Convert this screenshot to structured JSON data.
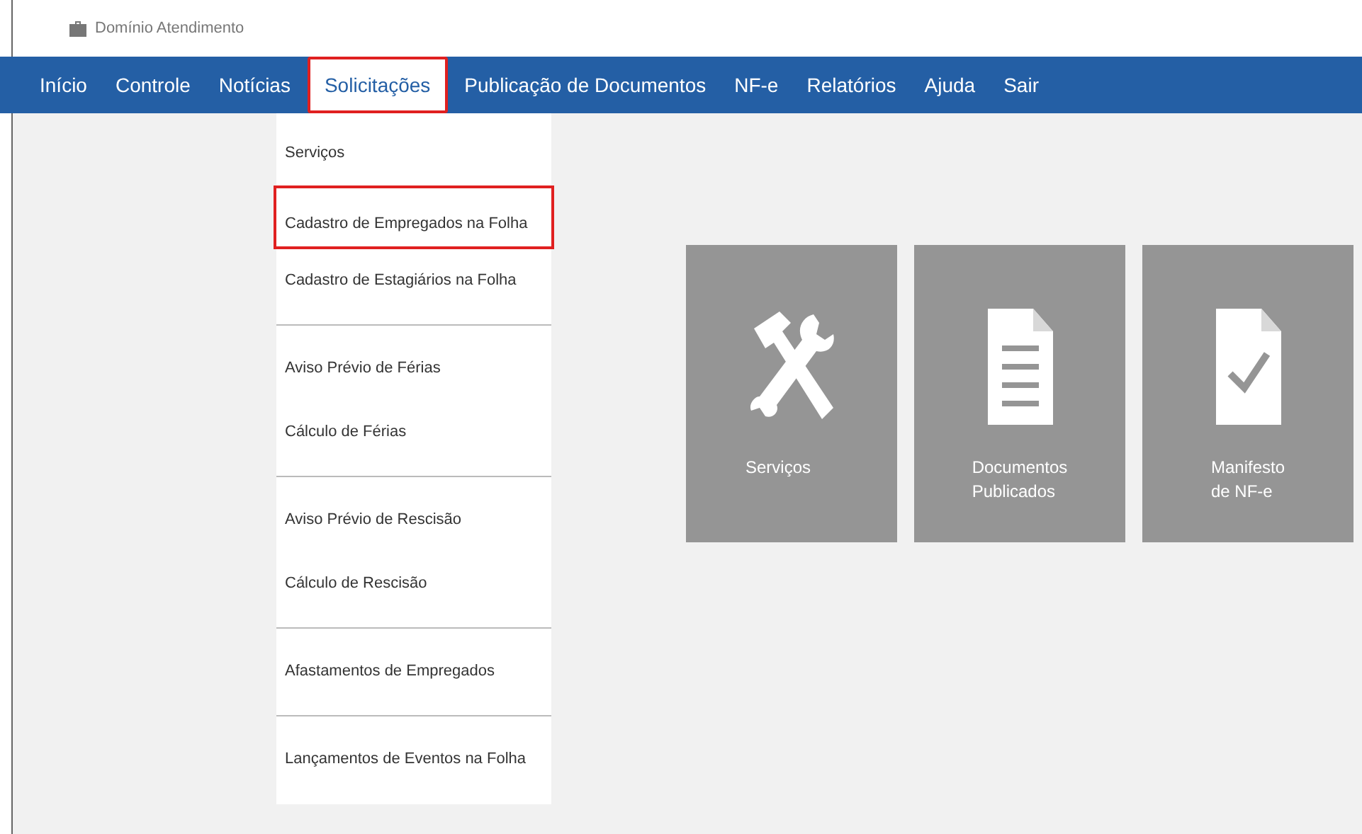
{
  "header": {
    "title": "Domínio Atendimento"
  },
  "nav": [
    {
      "label": "Início",
      "selected": false
    },
    {
      "label": "Controle",
      "selected": false
    },
    {
      "label": "Notícias",
      "selected": false
    },
    {
      "label": "Solicitações",
      "selected": true
    },
    {
      "label": "Publicação de Documentos",
      "selected": false
    },
    {
      "label": "NF-e",
      "selected": false
    },
    {
      "label": "Relatórios",
      "selected": false
    },
    {
      "label": "Ajuda",
      "selected": false
    },
    {
      "label": "Sair",
      "selected": false
    }
  ],
  "dropdown": {
    "groups": [
      [
        {
          "label": "Serviços",
          "highlighted": false
        },
        {
          "label": "Cadastro de Empregados na Folha",
          "highlighted": true
        },
        {
          "label": "Cadastro de Estagiários na Folha",
          "highlighted": false
        }
      ],
      [
        {
          "label": "Aviso Prévio de Férias",
          "highlighted": false
        },
        {
          "label": "Cálculo de Férias",
          "highlighted": false
        }
      ],
      [
        {
          "label": "Aviso Prévio de Rescisão",
          "highlighted": false
        },
        {
          "label": "Cálculo de Rescisão",
          "highlighted": false
        }
      ],
      [
        {
          "label": "Afastamentos de Empregados",
          "highlighted": false
        }
      ],
      [
        {
          "label": "Lançamentos de Eventos na Folha",
          "highlighted": false
        }
      ]
    ]
  },
  "tiles": [
    {
      "kind": "tools",
      "lines": [
        "Serviços"
      ]
    },
    {
      "kind": "document",
      "lines": [
        "Documentos",
        "Publicados"
      ]
    },
    {
      "kind": "check-document",
      "lines": [
        "Manifesto",
        "de NF-e"
      ]
    }
  ]
}
